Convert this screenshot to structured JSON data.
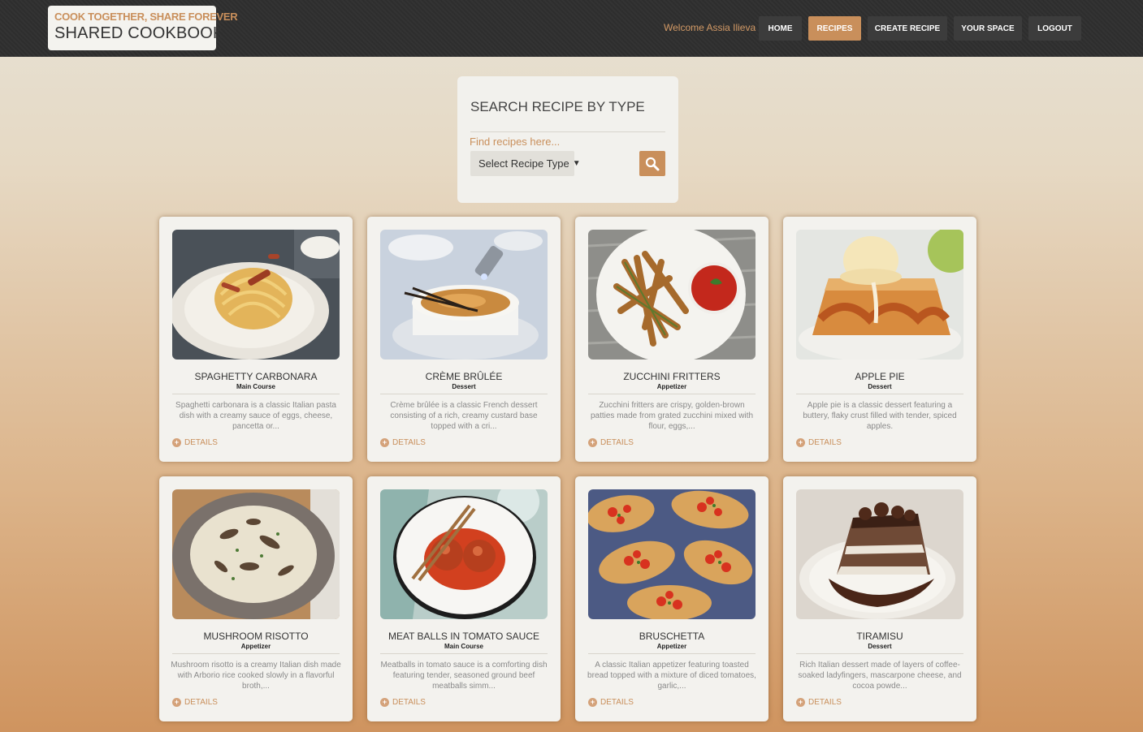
{
  "logo": {
    "tagline": "COOK TOGETHER, SHARE FOREVER",
    "name": "SHARED COOKBOOK"
  },
  "header": {
    "welcome": "Welcome Assia Ilieva",
    "nav": [
      {
        "label": "HOME"
      },
      {
        "label": "RECIPES",
        "active": true
      },
      {
        "label": "CREATE RECIPE"
      },
      {
        "label": "YOUR SPACE"
      },
      {
        "label": "LOGOUT"
      }
    ]
  },
  "search": {
    "title": "SEARCH RECIPE BY TYPE",
    "placeholder": "Find recipes here...",
    "select_value": "Select Recipe Type",
    "button_icon": "search-icon"
  },
  "details_label": "DETAILS",
  "recipes": [
    {
      "title": "SPAGHETTY CARBONARA",
      "type": "Main Course",
      "description": "Spaghetti carbonara is a classic Italian pasta dish with a creamy sauce of eggs, cheese, pancetta or..."
    },
    {
      "title": "CRÈME BRÛLÉE",
      "type": "Dessert",
      "description": "Crème brûlée is a classic French dessert consisting of a rich, creamy custard base topped with a cri..."
    },
    {
      "title": "ZUCCHINI FRITTERS",
      "type": "Appetizer",
      "description": "Zucchini fritters are crispy, golden-brown patties made from grated zucchini mixed with flour, eggs,..."
    },
    {
      "title": "APPLE PIE",
      "type": "Dessert",
      "description": "Apple pie is a classic dessert featuring a buttery, flaky crust filled with tender, spiced apples."
    },
    {
      "title": "MUSHROOM RISOTTO",
      "type": "Appetizer",
      "description": "Mushroom risotto is a creamy Italian dish made with Arborio rice cooked slowly in a flavorful broth,..."
    },
    {
      "title": "MEAT BALLS IN TOMATO SAUCE",
      "type": "Main Course",
      "description": "Meatballs in tomato sauce is a comforting dish featuring tender, seasoned ground beef meatballs simm..."
    },
    {
      "title": "BRUSCHETTA",
      "type": "Appetizer",
      "description": "A classic Italian appetizer featuring toasted bread topped with a mixture of diced tomatoes, garlic,..."
    },
    {
      "title": "TIRAMISU",
      "type": "Dessert",
      "description": "Rich Italian dessert made of layers of coffee-soaked ladyfingers, mascarpone cheese, and cocoa powde..."
    }
  ],
  "colors": {
    "accent": "#c98f5b",
    "header_bg": "#2f2f2f",
    "card_bg": "#f3f2ee"
  }
}
